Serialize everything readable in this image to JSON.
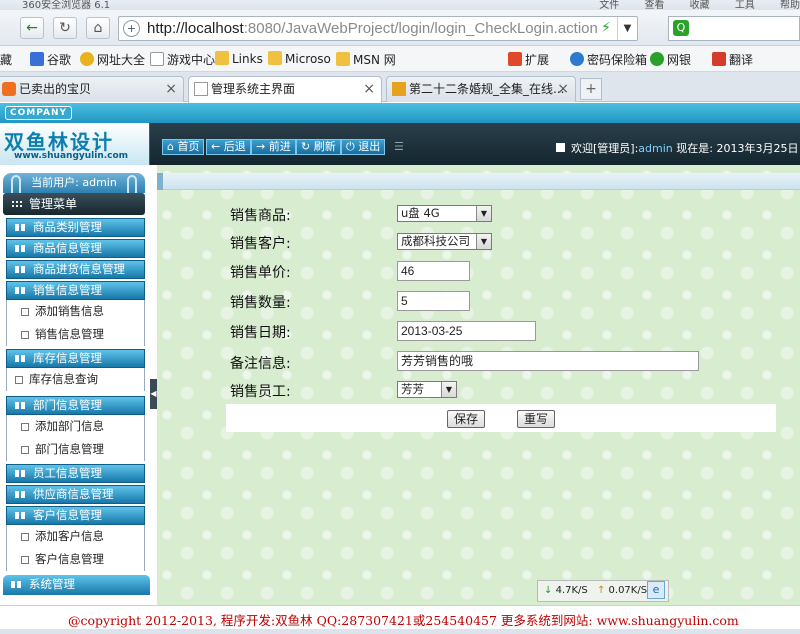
{
  "browser": {
    "title": "360安全浏览器 6.1",
    "menu": [
      "文件",
      "查看",
      "收藏",
      "工具",
      "帮助"
    ],
    "url_host": "http://localhost",
    "url_rest": ":8080/JavaWebProject/login/login_CheckLogin.action",
    "favorites": [
      {
        "label": "藏"
      },
      {
        "label": "谷歌"
      },
      {
        "label": "网址大全"
      },
      {
        "label": "游戏中心"
      },
      {
        "label": "Links"
      },
      {
        "label": "Microso"
      },
      {
        "label": "MSN 网"
      },
      {
        "label": "扩展"
      },
      {
        "label": "密码保险箱"
      },
      {
        "label": "网银"
      },
      {
        "label": "翻译"
      }
    ],
    "tabs": [
      {
        "label": "已卖出的宝贝"
      },
      {
        "label": "管理系统主界面"
      },
      {
        "label": "第二十二条婚规_全集_在线..."
      }
    ],
    "speed_down": "4.7K/S",
    "speed_up": "0.07K/S"
  },
  "header": {
    "company": "COMPANY",
    "logo_text": "双鱼林设计",
    "logo_url": "www.shuangyulin.com",
    "nav": [
      "首页",
      "后退",
      "前进",
      "刷新",
      "退出"
    ],
    "welcome_prefix": "欢迎[管理员]:",
    "welcome_user": "admin",
    "now_label": "现在是: 2013年3月25日 1"
  },
  "sidebar": {
    "current_user": "当前用户: admin",
    "menu_title": "管理菜单",
    "items": [
      {
        "label": "商品类别管理"
      },
      {
        "label": "商品信息管理"
      },
      {
        "label": "商品进货信息管理"
      },
      {
        "label": "销售信息管理"
      },
      {
        "label": "添加销售信息"
      },
      {
        "label": "销售信息管理"
      },
      {
        "label": "库存信息管理"
      },
      {
        "label": "库存信息查询"
      },
      {
        "label": "部门信息管理"
      },
      {
        "label": "添加部门信息"
      },
      {
        "label": "部门信息管理"
      },
      {
        "label": "员工信息管理"
      },
      {
        "label": "供应商信息管理"
      },
      {
        "label": "客户信息管理"
      },
      {
        "label": "添加客户信息"
      },
      {
        "label": "客户信息管理"
      }
    ],
    "system": "系统管理"
  },
  "form": {
    "product_label": "销售商品:",
    "product_value": "u盘 4G",
    "customer_label": "销售客户:",
    "customer_value": "成都科技公司",
    "price_label": "销售单价:",
    "price_value": "46",
    "qty_label": "销售数量:",
    "qty_value": "5",
    "date_label": "销售日期:",
    "date_value": "2013-03-25",
    "note_label": "备注信息:",
    "note_value": "芳芳销售的哦",
    "staff_label": "销售员工:",
    "staff_value": "芳芳",
    "save": "保存",
    "reset": "重写"
  },
  "footer": {
    "text": "@copyright 2012-2013, 程序开发:双鱼林  QQ:287307421或254540457  更多系统到网站: www.shuangyulin.com"
  }
}
